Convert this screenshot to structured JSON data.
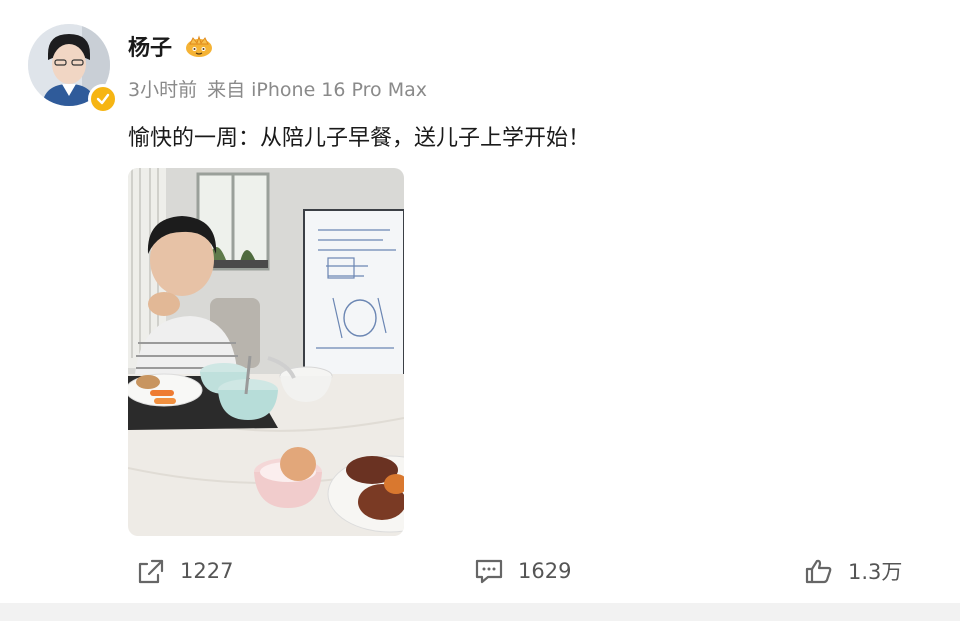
{
  "post": {
    "username": "杨子",
    "time": "3小时前",
    "source": "来自 iPhone 16 Pro Max",
    "text": "愉快的一周：从陪儿子早餐，送儿子上学开始！"
  },
  "actions": {
    "share_count": "1227",
    "comment_count": "1629",
    "like_count": "1.3万"
  },
  "icons": {
    "badge": "verified-badge-icon",
    "member": "crown-icon",
    "share": "share-icon",
    "comment": "comment-icon",
    "like": "thumbs-up-icon"
  },
  "colors": {
    "badge": "#f6b513",
    "meta_text": "#8a8a8a",
    "action_text": "#555555"
  }
}
